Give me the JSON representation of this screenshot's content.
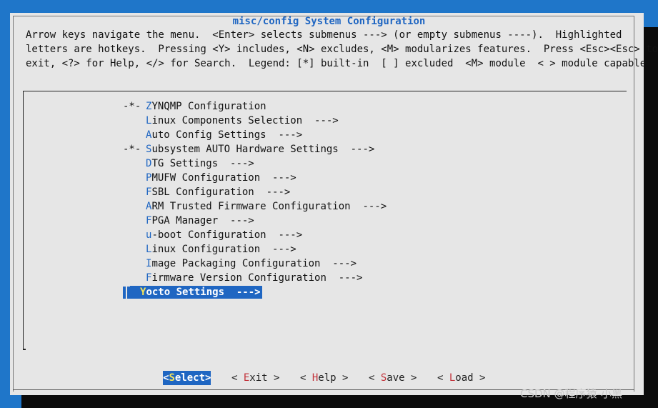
{
  "title": "misc/config System Configuration",
  "help_lines": [
    "Arrow keys navigate the menu.  <Enter> selects submenus ---> (or empty submenus ----).  Highlighted",
    "letters are hotkeys.  Pressing <Y> includes, <N> excludes, <M> modularizes features.  Press <Esc><Esc> to",
    "exit, <?> for Help, </> for Search.  Legend: [*] built-in  [ ] excluded  <M> module  < > module capable"
  ],
  "menu": [
    {
      "prefix": "-*-",
      "hot": "Z",
      "rest": "YNQMP Configuration"
    },
    {
      "prefix": "",
      "hot": "L",
      "rest": "inux Components Selection  --->"
    },
    {
      "prefix": "",
      "hot": "A",
      "rest": "uto Config Settings  --->"
    },
    {
      "prefix": "-*-",
      "hot": "S",
      "rest": "ubsystem AUTO Hardware Settings  --->"
    },
    {
      "prefix": "",
      "hot": "D",
      "rest": "TG Settings  --->"
    },
    {
      "prefix": "",
      "hot": "P",
      "rest": "MUFW Configuration  --->"
    },
    {
      "prefix": "",
      "hot": "F",
      "rest": "SBL Configuration  --->"
    },
    {
      "prefix": "",
      "hot": "A",
      "rest": "RM Trusted Firmware Configuration  --->"
    },
    {
      "prefix": "",
      "hot": "F",
      "rest": "PGA Manager  --->"
    },
    {
      "prefix": "",
      "hot": "u",
      "rest": "-boot Configuration  --->"
    },
    {
      "prefix": "",
      "hot": "L",
      "rest": "inux Configuration  --->"
    },
    {
      "prefix": "",
      "hot": "I",
      "rest": "mage Packaging Configuration  --->"
    },
    {
      "prefix": "",
      "hot": "F",
      "rest": "irmware Version Configuration  --->"
    },
    {
      "prefix": "",
      "hot": "Y",
      "rest": "octo Settings  --->",
      "selected": true
    }
  ],
  "buttons": [
    {
      "open": "<",
      "hot": "S",
      "rest": "elect",
      "close": ">",
      "active": true
    },
    {
      "open": "< ",
      "hot": "E",
      "rest": "xit",
      "close": " >",
      "active": false
    },
    {
      "open": "< ",
      "hot": "H",
      "rest": "elp",
      "close": " >",
      "active": false
    },
    {
      "open": "< ",
      "hot": "S",
      "rest": "ave",
      "close": " >",
      "active": false
    },
    {
      "open": "< ",
      "hot": "L",
      "rest": "oad",
      "close": " >",
      "active": false
    }
  ],
  "watermark": "CSDN @程序猿-小黑"
}
